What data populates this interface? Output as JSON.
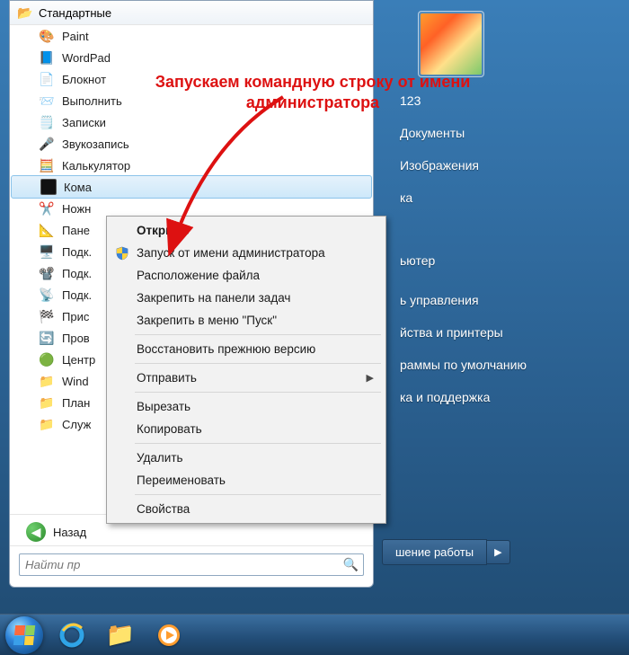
{
  "annotation": {
    "line1": "Запускаем командную строку от имени",
    "line2": "администратора"
  },
  "start_menu": {
    "folder_title": "Стандартные",
    "items": [
      {
        "label": "Paint",
        "icon": "paint-icon"
      },
      {
        "label": "WordPad",
        "icon": "wordpad-icon"
      },
      {
        "label": "Блокнот",
        "icon": "notepad-icon"
      },
      {
        "label": "Выполнить",
        "icon": "run-icon"
      },
      {
        "label": "Записки",
        "icon": "sticky-notes-icon"
      },
      {
        "label": "Звукозапись",
        "icon": "sound-recorder-icon"
      },
      {
        "label": "Калькулятор",
        "icon": "calculator-icon"
      },
      {
        "label": "Кома",
        "icon": "cmd-icon",
        "selected": true
      },
      {
        "label": "Ножн",
        "icon": "snipping-icon"
      },
      {
        "label": "Пане",
        "icon": "math-panel-icon"
      },
      {
        "label": "Подк.",
        "icon": "rdp-icon"
      },
      {
        "label": "Подк.",
        "icon": "projector-icon"
      },
      {
        "label": "Подк.",
        "icon": "network-projector-icon"
      },
      {
        "label": "Прис",
        "icon": "getting-started-icon"
      },
      {
        "label": "Пров",
        "icon": "explorer-icon"
      },
      {
        "label": "Центр",
        "icon": "sync-center-icon"
      },
      {
        "label": "Wind",
        "icon": "folder-icon"
      },
      {
        "label": "План",
        "icon": "tablet-folder-icon"
      },
      {
        "label": "Служ",
        "icon": "system-tools-folder-icon"
      }
    ],
    "back_label": "Назад",
    "search_placeholder": "Найти пр"
  },
  "right_column": {
    "user_name": "123",
    "links": [
      "Документы",
      "Изображения",
      "ка",
      "ьютер",
      "ь управления",
      "йства и принтеры",
      "раммы по умолчанию",
      "ка и поддержка"
    ],
    "shutdown_label": "шение работы"
  },
  "context_menu": {
    "items": [
      {
        "label": "Открыть",
        "bold": true
      },
      {
        "label": "Запуск от имени администратора",
        "shield": true
      },
      {
        "label": "Расположение файла"
      },
      {
        "label": "Закрепить на панели задач"
      },
      {
        "label": "Закрепить в меню \"Пуск\""
      },
      {
        "sep": true
      },
      {
        "label": "Восстановить прежнюю версию"
      },
      {
        "sep": true
      },
      {
        "label": "Отправить",
        "submenu": true
      },
      {
        "sep": true
      },
      {
        "label": "Вырезать"
      },
      {
        "label": "Копировать"
      },
      {
        "sep": true
      },
      {
        "label": "Удалить"
      },
      {
        "label": "Переименовать"
      },
      {
        "sep": true
      },
      {
        "label": "Свойства"
      }
    ]
  },
  "taskbar": {
    "pinned": [
      "start-orb",
      "ie-icon",
      "explorer-folder-icon",
      "media-player-icon"
    ]
  }
}
